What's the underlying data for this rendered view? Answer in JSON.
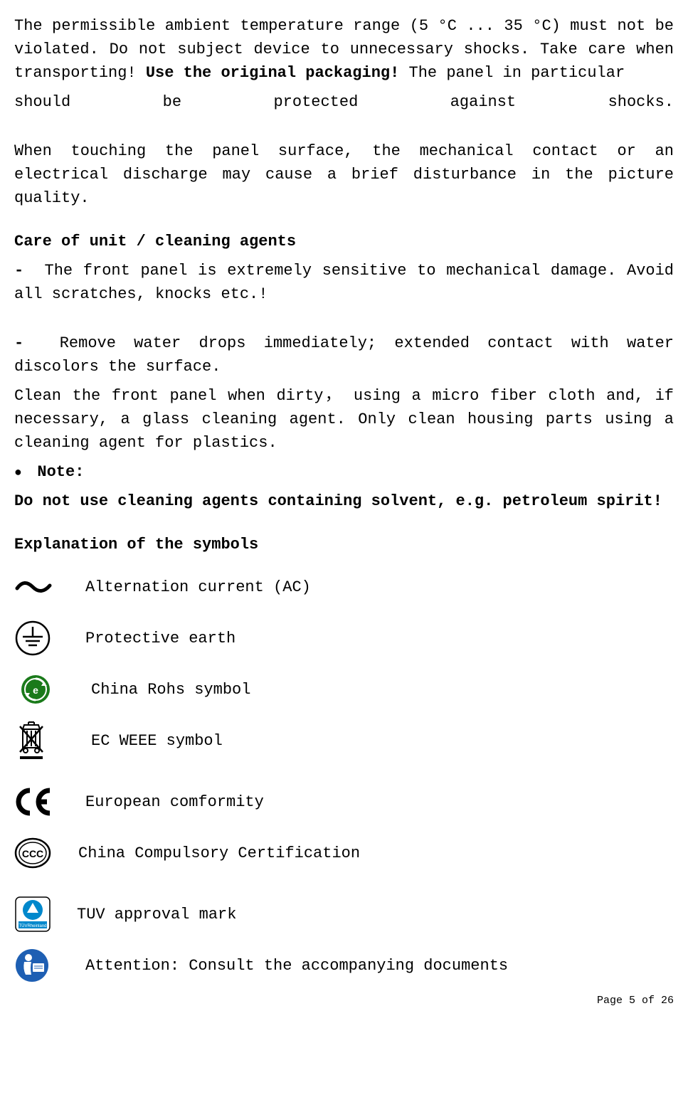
{
  "paragraphs": {
    "temp": "The permissible ambient temperature range (5 °C ... 35 °C) must not be violated.  Do not subject device to unnecessary shocks. Take care when transporting! ",
    "packaging": "Use the original packaging! ",
    "panel_protect": "The panel in particular",
    "panel_words": {
      "w1": "should",
      "w2": "be",
      "w3": "protected",
      "w4": "against",
      "w5": "shocks."
    },
    "touch": "When touching the panel surface, the mechanical contact or an electrical discharge may cause a brief disturbance in the picture quality."
  },
  "care": {
    "heading": "Care of unit / cleaning agents",
    "item1": "The front panel is extremely sensitive to mechanical damage. Avoid all scratches, knocks etc.!",
    "item2": "Remove water drops immediately; extended contact with water discolors the surface.",
    "clean": "Clean the front panel when dirty， using a micro fiber cloth and, if necessary, a glass cleaning agent. Only clean housing parts using a cleaning agent for plastics.",
    "note_label": "Note:",
    "note_text": "Do not use cleaning agents containing solvent, e.g. petroleum spirit!"
  },
  "symbols": {
    "heading": "Explanation of the symbols",
    "ac": "Alternation current (AC)",
    "earth": "Protective earth",
    "rohs": "China Rohs symbol",
    "weee": "EC WEEE symbol",
    "ce": "European comformity",
    "ccc": "China Compulsory Certification",
    "tuv": "TUV approval mark",
    "attention": "Attention: Consult the accompanying documents"
  },
  "footer": "Page 5 of 26"
}
